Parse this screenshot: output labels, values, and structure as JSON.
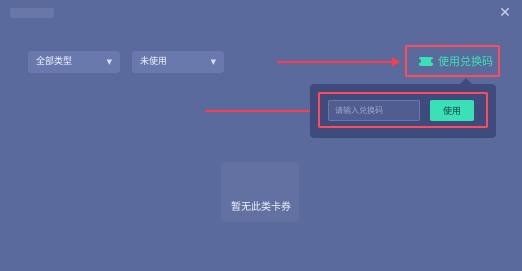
{
  "dialog": {
    "close_icon": "close-icon"
  },
  "filters": {
    "type": {
      "selected": "全部类型",
      "icon": "chevron-down-icon"
    },
    "status": {
      "selected": "未使用",
      "icon": "chevron-down-icon"
    }
  },
  "redeem": {
    "button_label": "使用兑换码",
    "icon": "ticket-icon",
    "accent_color": "#39e2b6"
  },
  "popup": {
    "input_placeholder": "请输入兑换码",
    "input_value": "",
    "use_button_label": "使用"
  },
  "empty_state": {
    "message": "暂无此类卡券"
  },
  "annotation": {
    "highlight_color": "#ff4b5a"
  }
}
